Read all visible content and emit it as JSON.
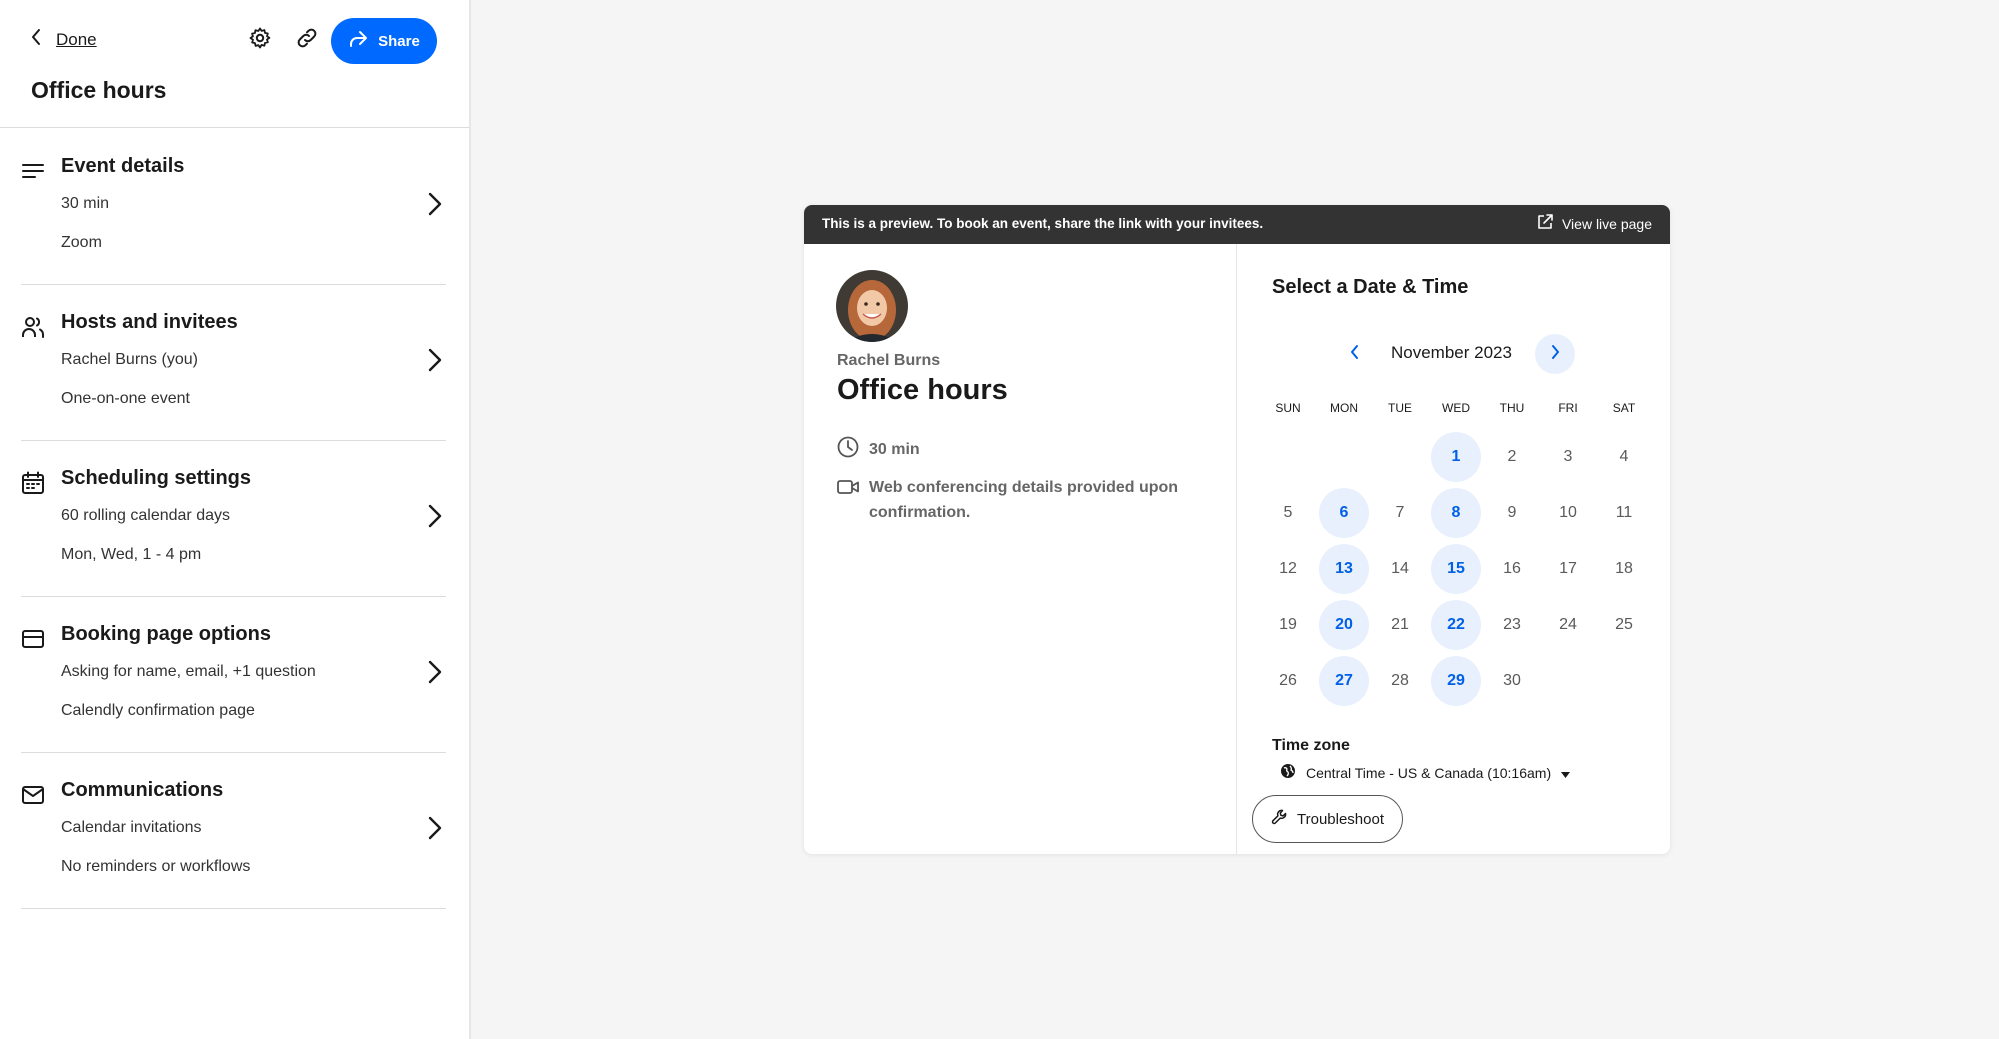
{
  "topbar": {
    "back_label": "Done",
    "share_label": "Share",
    "page_title": "Office hours"
  },
  "sections": [
    {
      "title": "Event details",
      "line1": "30 min",
      "line2": "Zoom"
    },
    {
      "title": "Hosts and invitees",
      "line1": "Rachel Burns (you)",
      "line2": "One-on-one event"
    },
    {
      "title": "Scheduling settings",
      "line1": "60 rolling calendar days",
      "line2": "Mon, Wed, 1 - 4 pm"
    },
    {
      "title": "Booking page options",
      "line1": "Asking for name, email, +1 question",
      "line2": "Calendly confirmation page"
    },
    {
      "title": "Communications",
      "line1": "Calendar invitations",
      "line2": "No reminders or workflows"
    }
  ],
  "preview": {
    "banner_text": "This is a preview. To book an event, share the link with your invitees.",
    "view_live_label": "View live page",
    "host_name": "Rachel Burns",
    "event_title": "Office hours",
    "duration": "30 min",
    "conferencing": "Web conferencing details provided upon confirmation.",
    "select_title": "Select a Date & Time",
    "month_label": "November 2023",
    "weekdays": [
      "SUN",
      "MON",
      "TUE",
      "WED",
      "THU",
      "FRI",
      "SAT"
    ],
    "first_weekday_index": 3,
    "days_in_month": 30,
    "available_days": [
      1,
      6,
      8,
      13,
      15,
      20,
      22,
      27,
      29
    ],
    "timezone_label": "Time zone",
    "timezone_value": "Central Time - US & Canada (10:16am)",
    "troubleshoot_label": "Troubleshoot"
  },
  "colors": {
    "accent": "#0069ff",
    "available_bg": "#e8f0fe",
    "available_text": "#0060e6",
    "banner_bg": "#333333"
  },
  "icons": [
    "chevron-left-icon",
    "gear-icon",
    "link-icon",
    "share-arrow-icon",
    "list-icon",
    "people-icon",
    "calendar-icon",
    "card-icon",
    "mail-icon",
    "chevron-right-icon",
    "external-link-icon",
    "clock-icon",
    "video-icon",
    "globe-icon",
    "wrench-icon"
  ]
}
